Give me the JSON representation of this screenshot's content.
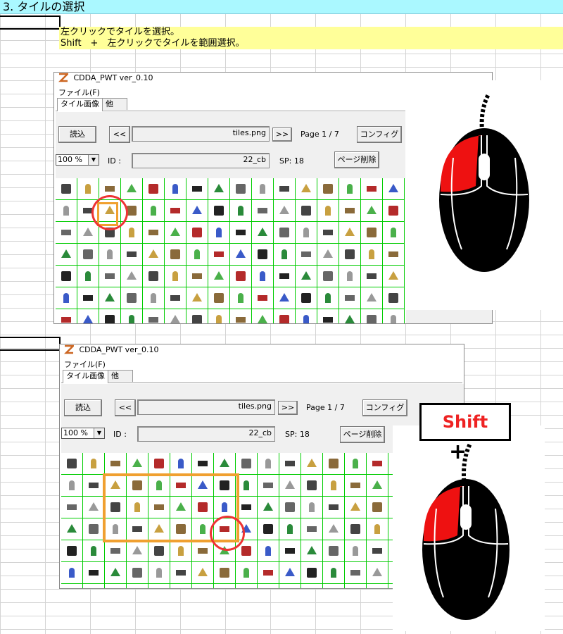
{
  "heading": "3. タイルの選択",
  "notes": [
    "左クリックでタイルを選択。",
    "Shift　+　左クリックでタイルを範囲選択。"
  ],
  "app": {
    "title": "CDDA_PWT  ver_0.10",
    "menu_file": "ファイル(F)",
    "tab_tiles": "タイル画像",
    "tab_other": "他",
    "load_button": "読込",
    "prev_button": "<<",
    "next_button": ">>",
    "file_name": "tiles.png",
    "page": "Page 1 / 7",
    "config_button": "コンフィグ",
    "zoom": "100 %",
    "id_label": "ID :",
    "id_value": "22_cb",
    "sp": "SP: 18",
    "delete_page_button": "ページ削除"
  },
  "shift_label": "Shift",
  "plus_label": "+",
  "colors": {
    "grid_line": "#00cc00",
    "highlight_rect": "#f0a030",
    "highlight_circle": "#ee3333",
    "mouse_button": "#ee1111"
  }
}
